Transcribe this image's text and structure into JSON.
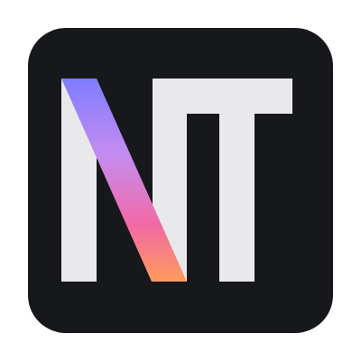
{
  "logo": {
    "text": "NT",
    "background_color": "#16181c",
    "letter_color": "#e9e9eb",
    "gradient_colors": [
      "#7f7dff",
      "#c58cf0",
      "#f26aa6",
      "#ff9a5c"
    ]
  }
}
